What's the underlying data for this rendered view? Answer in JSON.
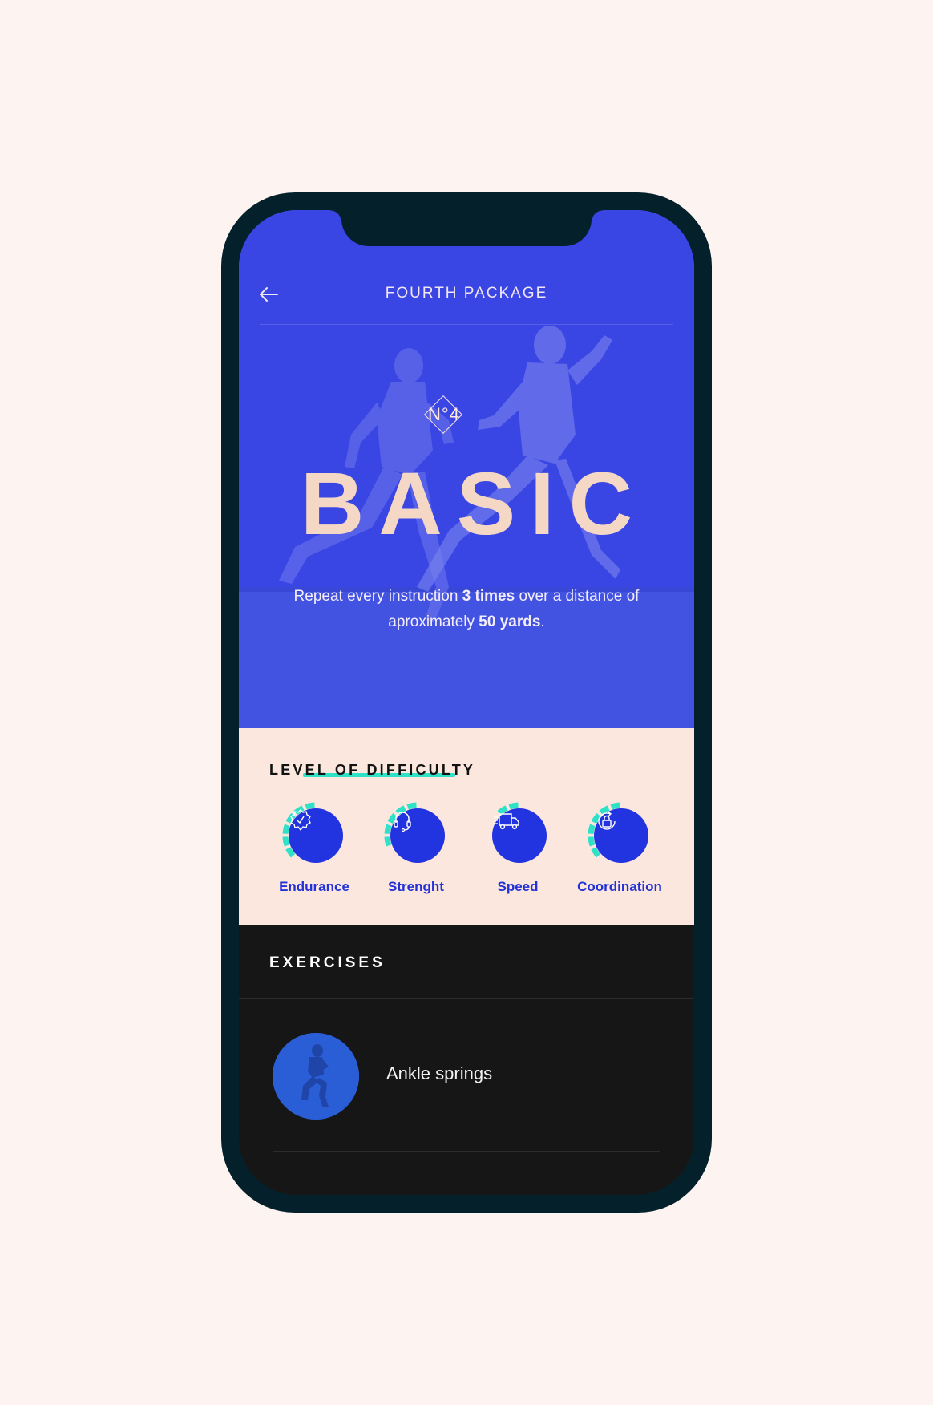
{
  "header": {
    "title": "FOURTH PACKAGE",
    "back_icon": "arrow-left-icon"
  },
  "hero": {
    "badge": "N°4",
    "title": "BASIC",
    "description_parts": {
      "p1": "Repeat every instruction ",
      "b1": "3 times",
      "p2": " over a distance of aproximately ",
      "b2": "50 yards",
      "p3": "."
    },
    "background_color": "#3a47e6"
  },
  "difficulty": {
    "heading": "LEVEL OF DIFFICULTY",
    "accent_color": "#2ee1c7",
    "skills": [
      {
        "label": "Endurance",
        "icon": "badge-check-icon",
        "level": 0.4
      },
      {
        "label": "Strenght",
        "icon": "headphones-icon",
        "level": 0.3
      },
      {
        "label": "Speed",
        "icon": "delivery-truck-icon",
        "level": 0.15
      },
      {
        "label": "Coordination",
        "icon": "lock-refresh-icon",
        "level": 0.4
      }
    ]
  },
  "exercises": {
    "heading": "EXERCISES",
    "items": [
      {
        "name": "Ankle springs"
      }
    ]
  }
}
